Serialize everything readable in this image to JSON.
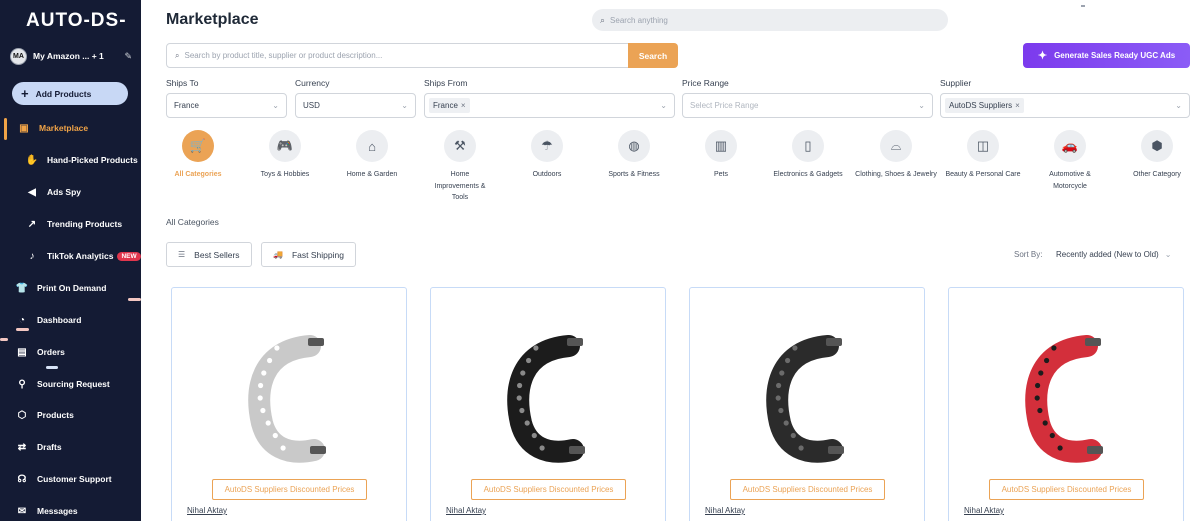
{
  "sidebar": {
    "logo": "AUTO-DS-",
    "account": {
      "initials": "MA",
      "name": "My Amazon ... + 1"
    },
    "add_products": "Add Products",
    "items": [
      {
        "label": "Marketplace",
        "icon": "bag-icon",
        "active": true
      },
      {
        "label": "Hand-Picked Products",
        "icon": "hand-icon"
      },
      {
        "label": "Ads Spy",
        "icon": "megaphone-icon"
      },
      {
        "label": "Trending Products",
        "icon": "trend-icon"
      },
      {
        "label": "TikTok Analytics",
        "icon": "tiktok-icon",
        "badge": "NEW"
      },
      {
        "label": "Print On Demand",
        "icon": "shirt-icon"
      },
      {
        "label": "Dashboard",
        "icon": "gauge-icon"
      },
      {
        "label": "Orders",
        "icon": "clipboard-icon"
      },
      {
        "label": "Sourcing Request",
        "icon": "sourcing-icon"
      },
      {
        "label": "Products",
        "icon": "cube-icon"
      },
      {
        "label": "Drafts",
        "icon": "drafts-icon"
      },
      {
        "label": "Customer Support",
        "icon": "headset-icon"
      },
      {
        "label": "Messages",
        "icon": "mail-icon"
      }
    ]
  },
  "header": {
    "title": "Marketplace",
    "global_search_placeholder": "Search anything"
  },
  "search": {
    "placeholder": "Search by product title, supplier or product description...",
    "button": "Search",
    "ugc_button": "Generate Sales Ready UGC Ads"
  },
  "filters": {
    "ships_to": {
      "label": "Ships To",
      "value": "France"
    },
    "currency": {
      "label": "Currency",
      "value": "USD"
    },
    "ships_from": {
      "label": "Ships From",
      "chip": "France"
    },
    "price_range": {
      "label": "Price Range",
      "placeholder": "Select Price Range"
    },
    "supplier": {
      "label": "Supplier",
      "chip": "AutoDS Suppliers"
    }
  },
  "categories": [
    {
      "label": "All Categories",
      "icon": "cart-icon",
      "active": true
    },
    {
      "label": "Toys & Hobbies",
      "icon": "gamepad-icon"
    },
    {
      "label": "Home & Garden",
      "icon": "house-icon"
    },
    {
      "label": "Home Improvements & Tools",
      "icon": "tools-icon"
    },
    {
      "label": "Outdoors",
      "icon": "umbrella-icon"
    },
    {
      "label": "Sports & Fitness",
      "icon": "ball-icon"
    },
    {
      "label": "Pets",
      "icon": "pet-food-icon"
    },
    {
      "label": "Electronics & Gadgets",
      "icon": "phone-icon"
    },
    {
      "label": "Clothing, Shoes & Jewelry",
      "icon": "hat-icon"
    },
    {
      "label": "Beauty & Personal Care",
      "icon": "beauty-icon"
    },
    {
      "label": "Automotive & Motorcycle",
      "icon": "car-icon"
    },
    {
      "label": "Other Category",
      "icon": "box-icon"
    }
  ],
  "listing": {
    "section_title": "All Categories",
    "tabs": [
      "Best Sellers",
      "Fast Shipping"
    ],
    "sort_label": "Sort By:",
    "sort_value": "Recently added (New to Old)"
  },
  "products": [
    {
      "tag": "AutoDS Suppliers Discounted Prices",
      "supplier": "Nihal Aktay",
      "color": "#c9c9c9",
      "holes": "#ffffff"
    },
    {
      "tag": "AutoDS Suppliers Discounted Prices",
      "supplier": "Nihal Aktay",
      "color": "#1c1c1c",
      "holes": "#8a8a8a"
    },
    {
      "tag": "AutoDS Suppliers Discounted Prices",
      "supplier": "Nihal Aktay",
      "color": "#2b2b2b",
      "holes": "#6b6b6b"
    },
    {
      "tag": "AutoDS Suppliers Discounted Prices",
      "supplier": "Nihal Aktay",
      "color": "#d32f3b",
      "holes": "#1c1c1c"
    }
  ],
  "colors": {
    "accent": "#eba355",
    "sidebar": "#141b34",
    "ugc": "#7c3aed"
  }
}
